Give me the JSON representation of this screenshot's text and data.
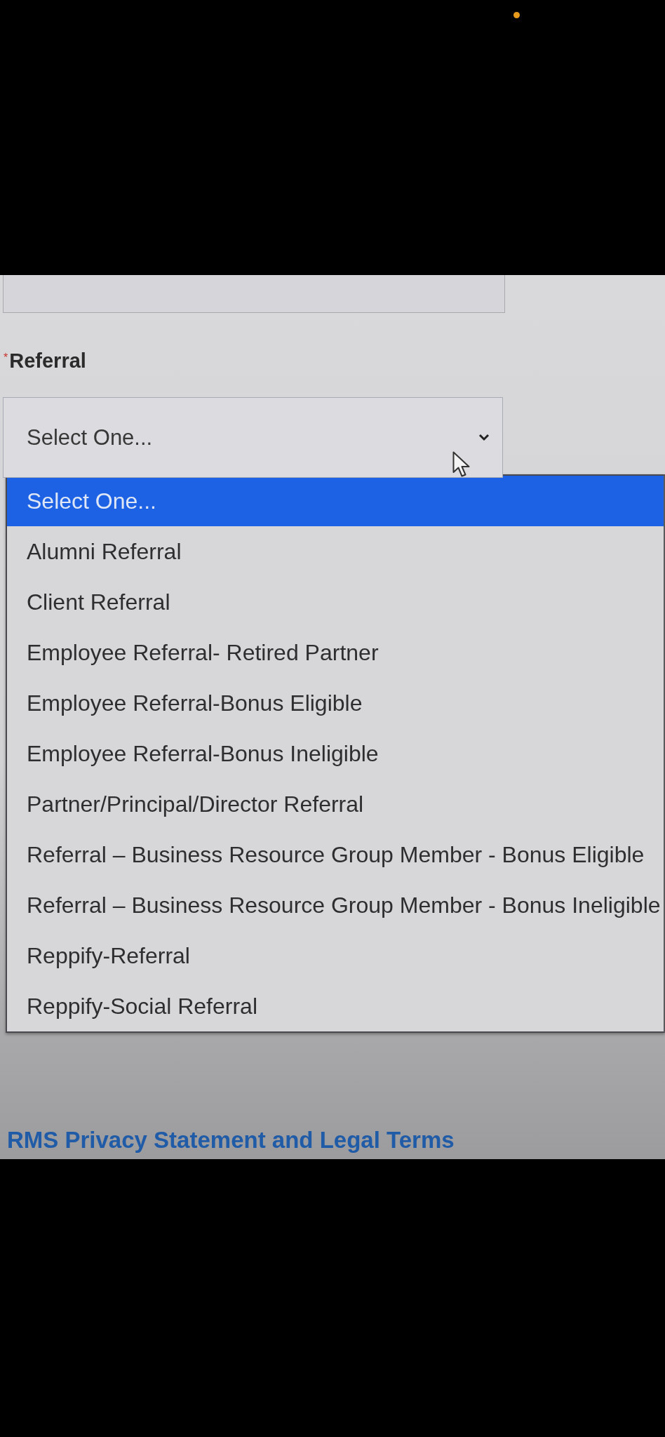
{
  "field": {
    "required_mark": "*",
    "label": "Referral",
    "value": "Select One...",
    "expanded": true
  },
  "dropdown": {
    "options": [
      {
        "label": "Select One...",
        "selected": true
      },
      {
        "label": "Alumni Referral",
        "selected": false
      },
      {
        "label": "Client Referral",
        "selected": false
      },
      {
        "label": "Employee Referral- Retired Partner",
        "selected": false
      },
      {
        "label": "Employee Referral-Bonus Eligible",
        "selected": false
      },
      {
        "label": "Employee Referral-Bonus Ineligible",
        "selected": false
      },
      {
        "label": "Partner/Principal/Director Referral",
        "selected": false
      },
      {
        "label": "Referral – Business Resource Group Member - Bonus Eligible",
        "selected": false
      },
      {
        "label": "Referral – Business Resource Group Member - Bonus Ineligible",
        "selected": false
      },
      {
        "label": "Reppify-Referral",
        "selected": false
      },
      {
        "label": "Reppify-Social Referral",
        "selected": false
      }
    ]
  },
  "footer": {
    "link": "RMS Privacy Statement and Legal Terms"
  }
}
